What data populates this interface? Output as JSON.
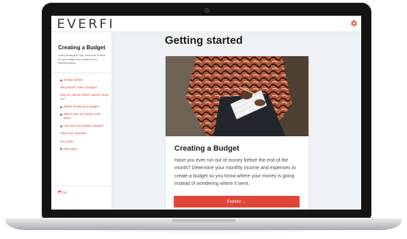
{
  "brand": {
    "logo_text": "EVERFI",
    "accent_color": "#e0453a"
  },
  "topbar": {
    "settings_icon": "gear-icon"
  },
  "sidebar": {
    "title": "Creating a Budget",
    "description": "Learn strategies, tips, and tools to stick to your budget and achieve your financial goals.",
    "items": [
      {
        "label": "Getting started",
        "status": "current"
      },
      {
        "label": "Why should I have a budget?",
        "status": "none"
      },
      {
        "label": "How do I decide what to spend money on?",
        "status": "none"
      },
      {
        "label": "What's breaking my budget?",
        "status": "complete"
      },
      {
        "label": "Where does my money come from?",
        "status": "complete"
      },
      {
        "label": "How does my budget compare?",
        "status": "complete"
      },
      {
        "label": "Track your expenses",
        "status": "none"
      },
      {
        "label": "Key points",
        "status": "none"
      },
      {
        "label": "Next steps",
        "status": "complete"
      }
    ],
    "exit_label": "Exit",
    "exit_icon": "flag-icon"
  },
  "main": {
    "title": "Getting started",
    "card": {
      "title": "Creating a Budget",
      "body": "Have you ever run out of money before the end of the month? Determine your monthly income and expenses to create a budget so you know where your money is going instead of wondering where it went.",
      "button_label": "Explore →"
    }
  }
}
